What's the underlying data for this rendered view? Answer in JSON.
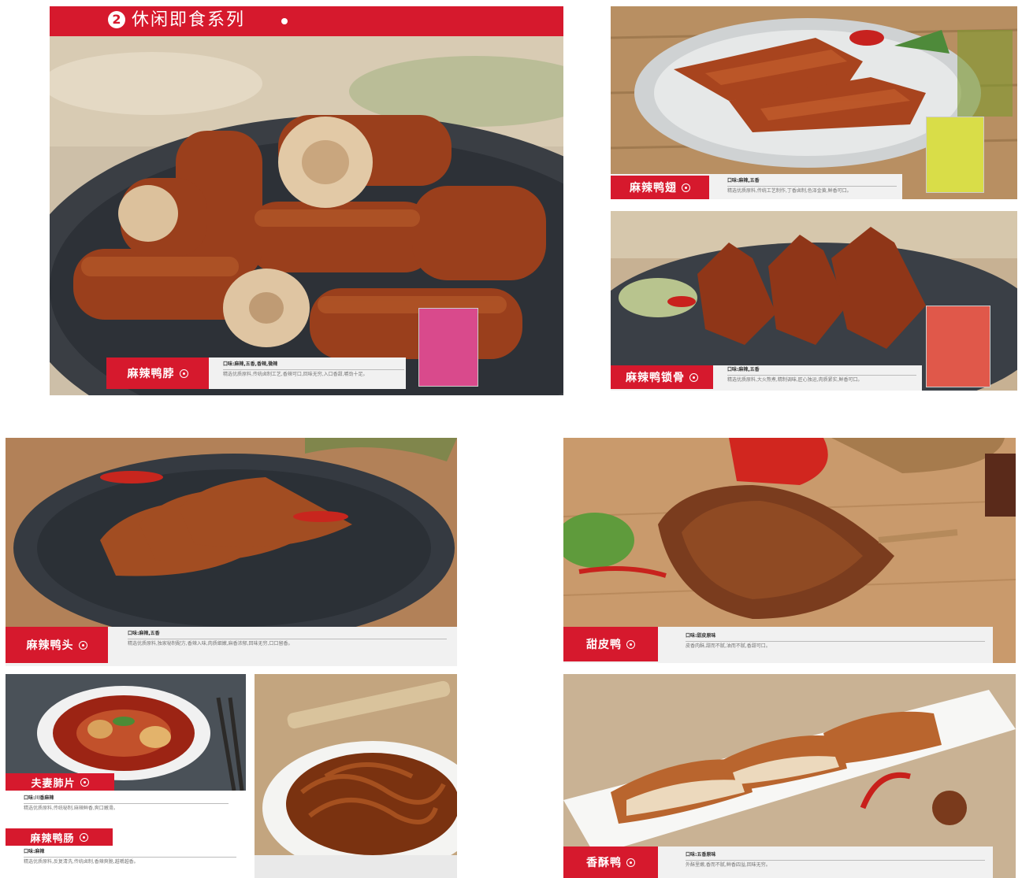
{
  "header": {
    "number": "2",
    "title": "休闲即食系列"
  },
  "products": {
    "neck": {
      "name": "麻辣鸭脖",
      "flavor": "口味:麻辣,五香,香辣,微辣",
      "desc": "精选优质原料,传统卤制工艺,香辣可口,回味无穷,入口香甜,嚼劲十足。"
    },
    "wing": {
      "name": "麻辣鸭翅",
      "flavor": "口味:麻辣,五香",
      "desc": "精选优质原料,传统工艺制作,丁香卤制,色泽金黄,鲜香可口。"
    },
    "rack": {
      "name": "麻辣鸭锁骨",
      "flavor": "口味:麻辣,五香",
      "desc": "精选优质原料,大火熬煮,精制调味,匠心独运,肉质紧实,鲜香可口。"
    },
    "head": {
      "name": "麻辣鸭头",
      "flavor": "口味:麻辣,五香",
      "desc": "精选优质原料,独家秘制配方,香辣入味,肉质细嫩,麻香浓郁,回味无穷,口口留香。"
    },
    "tian": {
      "name": "甜皮鸭",
      "flavor": "口味:甜皮原味",
      "desc": "皮香肉酥,甜而不腻,油而不腻,香甜可口。"
    },
    "lung": {
      "name": "夫妻肺片",
      "flavor": "口味:川香麻辣",
      "desc": "精选优质原料,传统秘制,麻辣鲜香,爽口嫩滑。"
    },
    "intestine": {
      "name": "麻辣鸭肠",
      "flavor": "口味:麻辣",
      "desc": "精选优质原料,反复清洗,传统卤制,香辣爽脆,越嚼越香。"
    },
    "crispy": {
      "name": "香酥鸭",
      "flavor": "口味:五香原味",
      "desc": "外酥里嫩,香而不腻,鲜香四溢,回味无穷。"
    }
  },
  "colors": {
    "accent": "#d6192d",
    "strip": "#f1f1f1"
  }
}
